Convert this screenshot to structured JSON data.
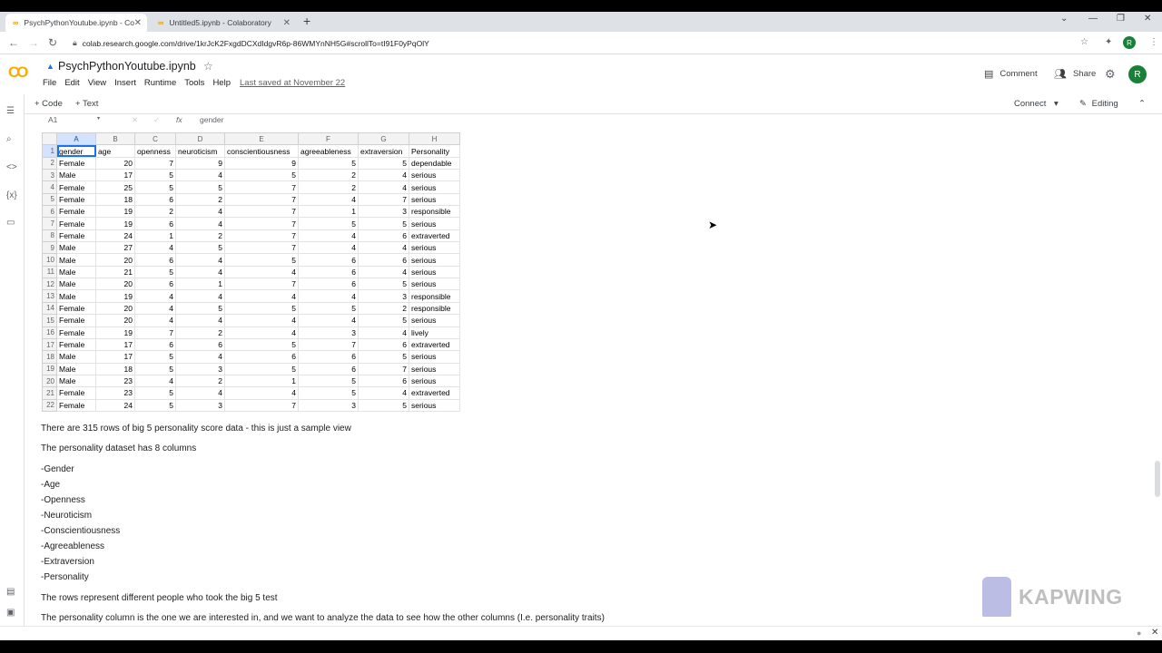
{
  "browser": {
    "tabs": [
      {
        "label": "PsychPythonYoutube.ipynb - Co",
        "active": true
      },
      {
        "label": "Untitled5.ipynb - Colaboratory",
        "active": false
      }
    ],
    "url": "colab.research.google.com/drive/1krJcK2FxgdDCXdIdgvR6p-86WMYnNH5G#scrollTo=tI91F0yPqOlY",
    "profile_initial": "R"
  },
  "colab": {
    "logo": "CO",
    "title": "PsychPythonYoutube.ipynb",
    "menu": [
      "File",
      "Edit",
      "View",
      "Insert",
      "Runtime",
      "Tools",
      "Help"
    ],
    "last_saved": "Last saved at November 22",
    "comment_label": "Comment",
    "share_label": "Share",
    "profile_initial": "R",
    "add_code_label": "+ Code",
    "add_text_label": "+ Text",
    "connect_label": "Connect",
    "editing_label": "Editing"
  },
  "sheet": {
    "cell_ref": "A1",
    "formula": "gender",
    "columns": [
      "A",
      "B",
      "C",
      "D",
      "E",
      "F",
      "G",
      "H"
    ],
    "header": [
      "gender",
      "age",
      "openness",
      "neuroticism",
      "conscientiousness",
      "agreeableness",
      "extraversion",
      "Personality"
    ],
    "rows": [
      [
        "Female",
        "20",
        "7",
        "9",
        "9",
        "5",
        "5",
        "dependable"
      ],
      [
        "Male",
        "17",
        "5",
        "4",
        "5",
        "2",
        "4",
        "serious"
      ],
      [
        "Female",
        "25",
        "5",
        "5",
        "7",
        "2",
        "4",
        "serious"
      ],
      [
        "Female",
        "18",
        "6",
        "2",
        "7",
        "4",
        "7",
        "serious"
      ],
      [
        "Female",
        "19",
        "2",
        "4",
        "7",
        "1",
        "3",
        "responsible"
      ],
      [
        "Female",
        "19",
        "6",
        "4",
        "7",
        "5",
        "5",
        "serious"
      ],
      [
        "Female",
        "24",
        "1",
        "2",
        "7",
        "4",
        "6",
        "extraverted"
      ],
      [
        "Male",
        "27",
        "4",
        "5",
        "7",
        "4",
        "4",
        "serious"
      ],
      [
        "Male",
        "20",
        "6",
        "4",
        "5",
        "6",
        "6",
        "serious"
      ],
      [
        "Male",
        "21",
        "5",
        "4",
        "4",
        "6",
        "4",
        "serious"
      ],
      [
        "Male",
        "20",
        "6",
        "1",
        "7",
        "6",
        "5",
        "serious"
      ],
      [
        "Male",
        "19",
        "4",
        "4",
        "4",
        "4",
        "3",
        "responsible"
      ],
      [
        "Female",
        "20",
        "4",
        "5",
        "5",
        "5",
        "2",
        "responsible"
      ],
      [
        "Female",
        "20",
        "4",
        "4",
        "4",
        "4",
        "5",
        "serious"
      ],
      [
        "Female",
        "19",
        "7",
        "2",
        "4",
        "3",
        "4",
        "lively"
      ],
      [
        "Female",
        "17",
        "6",
        "6",
        "5",
        "7",
        "6",
        "extraverted"
      ],
      [
        "Male",
        "17",
        "5",
        "4",
        "6",
        "6",
        "5",
        "serious"
      ],
      [
        "Male",
        "18",
        "5",
        "3",
        "5",
        "6",
        "7",
        "serious"
      ],
      [
        "Male",
        "23",
        "4",
        "2",
        "1",
        "5",
        "6",
        "serious"
      ],
      [
        "Female",
        "23",
        "5",
        "4",
        "4",
        "5",
        "4",
        "extraverted"
      ],
      [
        "Female",
        "24",
        "5",
        "3",
        "7",
        "3",
        "5",
        "serious"
      ]
    ]
  },
  "text": {
    "line1": "There are 315 rows of big 5 personality score data - this is just a sample view",
    "line2": "The personality dataset has 8 columns",
    "list": [
      "-Gender",
      "-Age",
      "-Openness",
      "-Neuroticism",
      "-Conscientiousness",
      "-Agreeableness",
      "-Extraversion",
      "-Personality"
    ],
    "line3": "The rows represent different people who took the big 5 test",
    "line4": "The personality column is the one we are interested in, and we want to analyze the data to see how the other columns (I.e. personality traits)"
  },
  "watermark": "KAPWING"
}
